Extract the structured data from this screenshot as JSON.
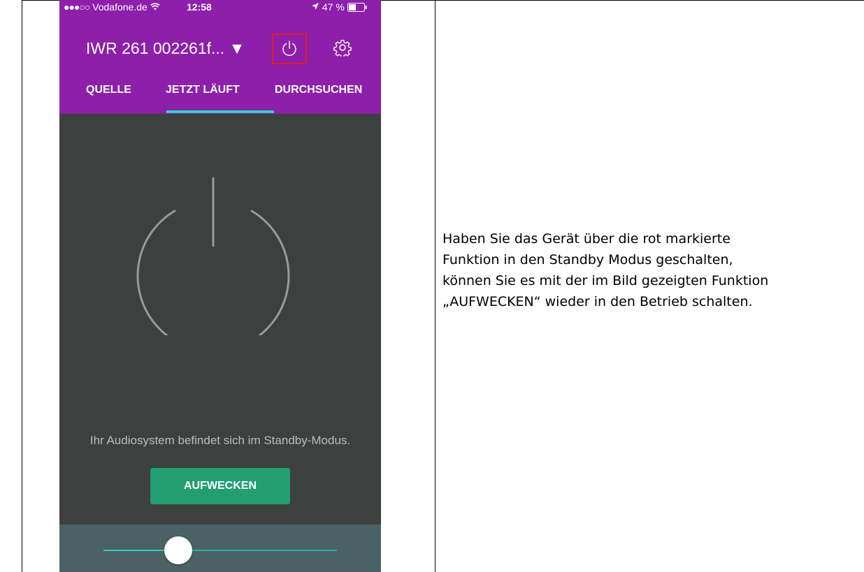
{
  "status_bar": {
    "signal_dots": "●●●○○",
    "carrier": "Vodafone.de",
    "time": "12:58",
    "battery_percent": "47 %"
  },
  "header": {
    "device_name": "IWR 261 002261f... ▼"
  },
  "tabs": [
    {
      "label": "QUELLE"
    },
    {
      "label": "JETZT LÄUFT",
      "active": true
    },
    {
      "label": "DURCHSUCHEN"
    }
  ],
  "main": {
    "standby_message": "Ihr Audiosystem befindet sich im Standby-Modus.",
    "wake_label": "AUFWECKEN"
  },
  "volume": {
    "level": 0.31
  },
  "description_lines": [
    "Haben Sie das Gerät über die rot markierte",
    "Funktion in den Standby Modus geschalten,",
    "können Sie es mit der im Bild gezeigten Funktion",
    "„AUFWECKEN“ wieder in den Betrieb schalten."
  ],
  "colors": {
    "header_purple": "#8d1fab",
    "tab_indicator": "#2bd0c4",
    "wake_button": "#239e72",
    "highlight_red": "#e0201c",
    "background_dark": "#3c403f"
  }
}
